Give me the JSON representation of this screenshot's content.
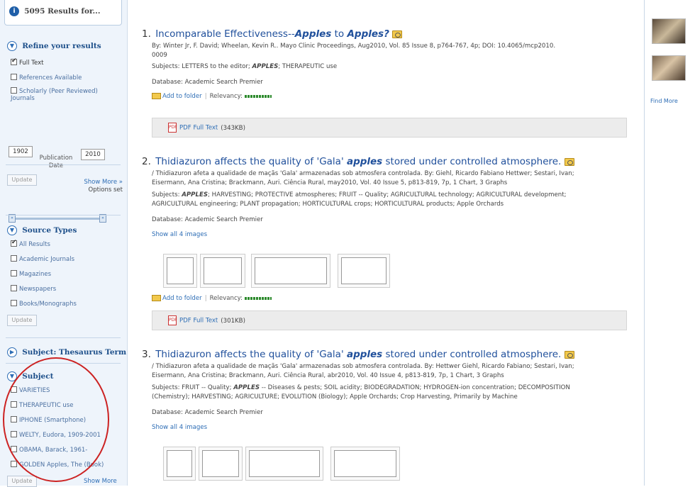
{
  "sidebar": {
    "results_count": "5095 Results for...",
    "refine": {
      "title": "Refine your results",
      "full_text": "Full Text",
      "references": "References Available",
      "scholarly": "Scholarly (Peer Reviewed) Journals",
      "date_from": "1902",
      "date_to": "2010",
      "pub_date_label": "Publication Date",
      "update": "Update",
      "show_more": "Show More »",
      "options_set": "Options set"
    },
    "source_types": {
      "title": "Source Types",
      "items": [
        "All Results",
        "Academic Journals",
        "Magazines",
        "Newspapers",
        "Books/Monographs"
      ],
      "update": "Update"
    },
    "thesaurus": {
      "title": "Subject: Thesaurus Term"
    },
    "subject": {
      "title": "Subject",
      "items": [
        "VARIETIES",
        "THERAPEUTIC use",
        "IPHONE (Smartphone)",
        "WELTY, Eudora, 1909-2001",
        "OBAMA, Barack, 1961-",
        "GOLDEN Apples, The (Book)"
      ],
      "update": "Update",
      "show_more": "Show More"
    }
  },
  "results": [
    {
      "num": "1.",
      "title_pre": "Incomparable Effectiveness--",
      "title_bold1": "Apples",
      "title_mid": " to ",
      "title_bold2": "Apples?",
      "byline": "By: Winter Jr, F. David; Wheelan, Kevin R.. Mayo Clinic Proceedings, Aug2010, Vol. 85 Issue 8, p764-767, 4p; DOI: 10.4065/mcp2010.",
      "byline2": "0009",
      "subjects_pre": "Subjects: LETTERS to the editor; ",
      "subjects_bold": "APPLES",
      "subjects_post": "; THERAPEUTIC use",
      "database": "Database: Academic Search Premier",
      "add_folder": "Add to folder",
      "relevancy": "Relevancy:",
      "pdf_label": "PDF Full Text",
      "pdf_size": "(343KB)"
    },
    {
      "num": "2.",
      "title_pre": "Thidiazuron affects the quality of 'Gala' ",
      "title_bold": "apples",
      "title_post": " stored under controlled atmosphere.",
      "line1": "/ Thidiazuron afeta a qualidade de maçãs 'Gala' armazenadas sob atmosfera controlada. By: Giehl, Ricardo Fabiano Hettwer; Sestari, Ivan;",
      "line2": "Eisermann, Ana Cristina; Brackmann, Auri. Ciência Rural, may2010, Vol. 40 Issue 5, p813-819, 7p, 1 Chart, 3 Graphs",
      "subjects_pre": "Subjects: ",
      "subjects_bold": "APPLES",
      "subjects_post": "; HARVESTING; PROTECTIVE atmospheres; FRUIT -- Quality; AGRICULTURAL technology; AGRICULTURAL development;",
      "subjects_line2": "AGRICULTURAL engineering; PLANT propagation; HORTICULTURAL crops; HORTICULTURAL products; Apple Orchards",
      "database": "Database: Academic Search Premier",
      "show_images": "Show all 4 images",
      "add_folder": "Add to folder",
      "relevancy": "Relevancy:",
      "pdf_label": "PDF Full Text",
      "pdf_size": "(301KB)"
    },
    {
      "num": "3.",
      "title_pre": "Thidiazuron affects the quality of 'Gala' ",
      "title_bold": "apples",
      "title_post": " stored under controlled atmosphere.",
      "line1": "/ Thidiazuron afeta a qualidade de maçãs 'Gala' armazenadas sob atmosfera controlada. By: Hettwer Giehl, Ricardo Fabiano; Sestari, Ivan;",
      "line2": "Eisermann, Ana Cristina; Brackmann, Auri. Ciência Rural, abr2010, Vol. 40 Issue 4, p813-819, 7p, 1 Chart, 3 Graphs",
      "subjects_pre": "Subjects: FRUIT -- Quality; ",
      "subjects_bold": "APPLES",
      "subjects_post": " -- Diseases & pests; SOIL acidity; BIODEGRADATION; HYDROGEN-ion concentration; DECOMPOSITION",
      "subjects_line2": "(Chemistry); HARVESTING; AGRICULTURE; EVOLUTION (Biology); Apple Orchards; Crop Harvesting, Primarily by Machine",
      "database": "Database: Academic Search Premier",
      "show_images": "Show all 4 images"
    }
  ],
  "rightbar": {
    "find_more": "Find More"
  }
}
